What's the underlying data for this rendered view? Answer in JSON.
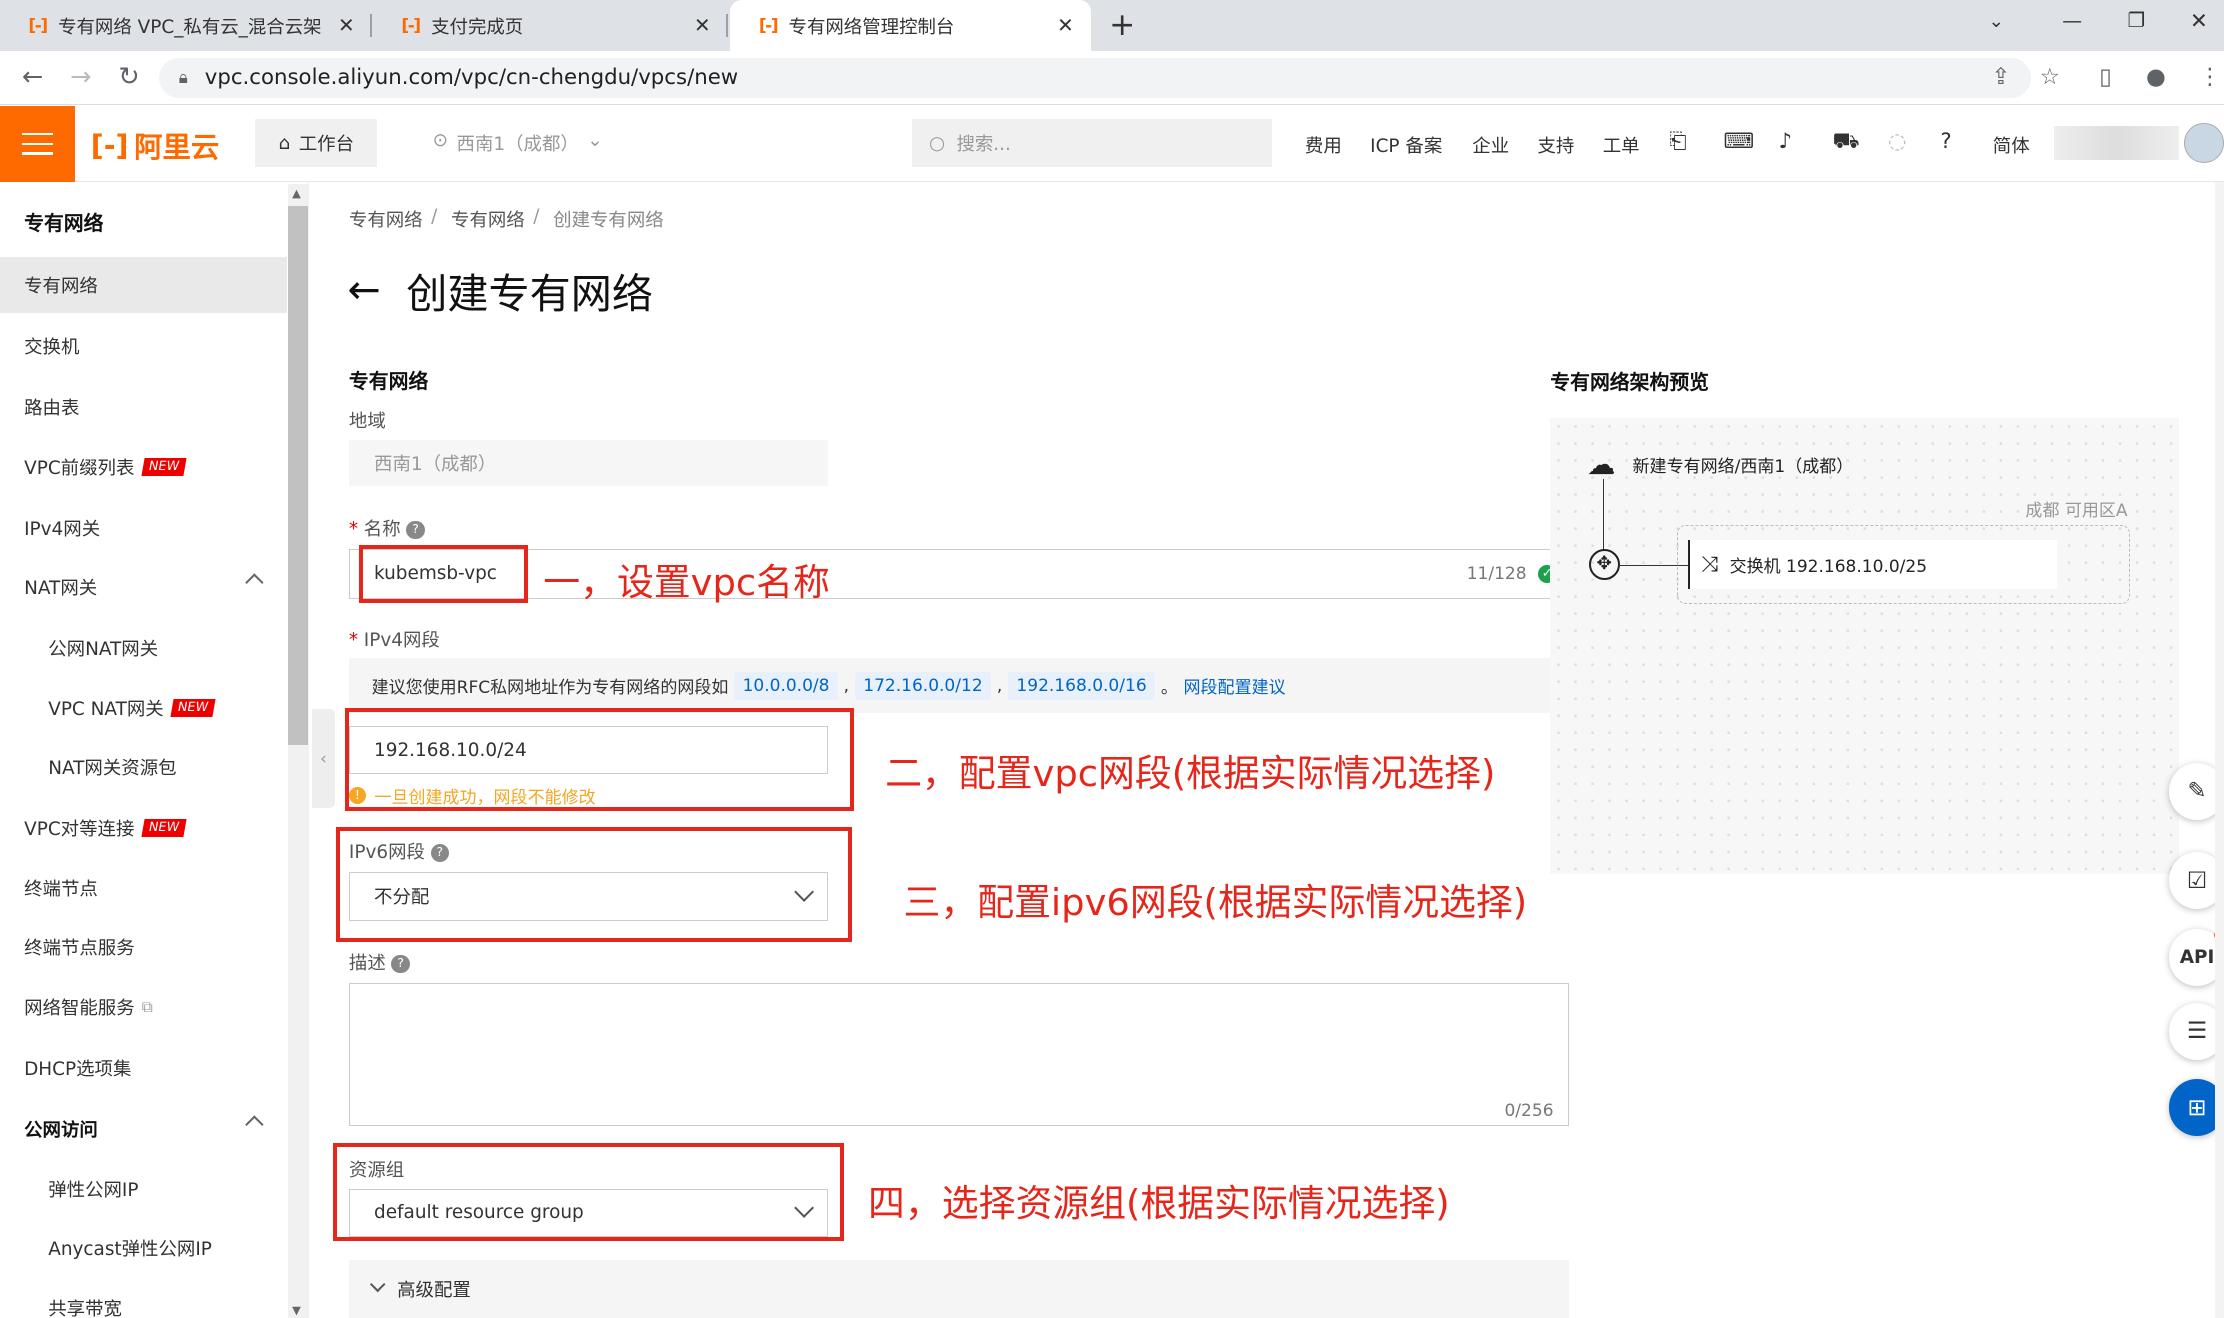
{
  "browser": {
    "tabs": [
      {
        "favicon": "[-]",
        "title": "专有网络 VPC_私有云_混合云架",
        "close": "✕"
      },
      {
        "favicon": "[-]",
        "title": "支付完成页",
        "close": "✕"
      },
      {
        "favicon": "[-]",
        "title": "专有网络管理控制台",
        "close": "✕"
      }
    ],
    "new_tab": "+",
    "url": "vpc.console.aliyun.com/vpc/cn-chengdu/vpcs/new"
  },
  "header": {
    "logo": "阿里云",
    "workbench": "工作台",
    "region": "西南1（成都）",
    "search_placeholder": "搜索...",
    "links": [
      "费用",
      "ICP 备案",
      "企业",
      "支持",
      "工单"
    ],
    "lang": "简体"
  },
  "sidebar": {
    "title": "专有网络",
    "items": [
      {
        "label": "专有网络"
      },
      {
        "label": "交换机"
      },
      {
        "label": "路由表"
      },
      {
        "label": "VPC前缀列表",
        "badge": "NEW"
      },
      {
        "label": "IPv4网关"
      },
      {
        "label": "NAT网关"
      },
      {
        "label": "公网NAT网关"
      },
      {
        "label": "VPC NAT网关",
        "badge": "NEW"
      },
      {
        "label": "NAT网关资源包"
      },
      {
        "label": "VPC对等连接",
        "badge": "NEW"
      },
      {
        "label": "终端节点"
      },
      {
        "label": "终端节点服务"
      },
      {
        "label": "网络智能服务"
      },
      {
        "label": "DHCP选项集"
      },
      {
        "label": "公网访问"
      },
      {
        "label": "弹性公网IP"
      },
      {
        "label": "Anycast弹性公网IP"
      },
      {
        "label": "共享带宽"
      }
    ]
  },
  "breadcrumb": [
    "专有网络",
    "专有网络",
    "创建专有网络"
  ],
  "breadcrumb_sep": "/",
  "page_title": "创建专有网络",
  "form": {
    "section": "专有网络",
    "region_label": "地域",
    "region_value": "西南1（成都）",
    "name_label": "名称",
    "name_value": "kubemsb-vpc",
    "name_count": "11/128",
    "ipv4_label": "IPv4网段",
    "ipv4_hint": "建议您使用RFC私网地址作为专有网络的网段如",
    "ipv4_suggestions": [
      "10.0.0.0/8",
      "172.16.0.0/12",
      "192.168.0.0/16"
    ],
    "ipv4_link": "网段配置建议",
    "ipv4_value": "192.168.10.0/24",
    "ipv4_warning": "一旦创建成功，网段不能修改",
    "ipv6_label": "IPv6网段",
    "ipv6_value": "不分配",
    "desc_label": "描述",
    "desc_count": "0/256",
    "rg_label": "资源组",
    "rg_value": "default resource group",
    "advanced": "高级配置"
  },
  "annotations": [
    "一，设置vpc名称",
    "二，配置vpc网段(根据实际情况选择)",
    "三，配置ipv6网段(根据实际情况选择)",
    "四，选择资源组(根据实际情况选择)"
  ],
  "preview": {
    "title": "专有网络架构预览",
    "vpc_node": "新建专有网络/西南1（成都）",
    "zone": "成都 可用区A",
    "switch": "交换机 192.168.10.0/25"
  },
  "fabs": [
    "edit-icon",
    "checklist-icon",
    "API",
    "chat-icon",
    "apps-icon"
  ],
  "colors": {
    "brand": "#ff6a00",
    "annotation": "#e5271b",
    "link": "#0064c8"
  }
}
